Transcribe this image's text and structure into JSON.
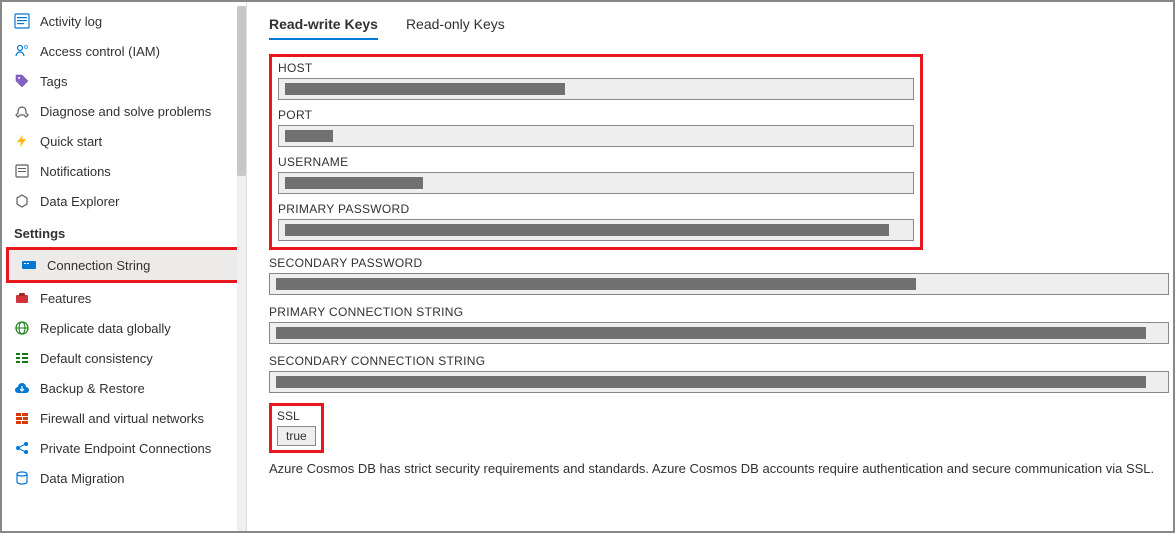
{
  "sidebar": {
    "top_items": [
      {
        "label": "Activity log",
        "icon": "activity"
      },
      {
        "label": "Access control (IAM)",
        "icon": "access"
      },
      {
        "label": "Tags",
        "icon": "tag"
      },
      {
        "label": "Diagnose and solve problems",
        "icon": "diagnose"
      },
      {
        "label": "Quick start",
        "icon": "quickstart"
      },
      {
        "label": "Notifications",
        "icon": "notifications"
      },
      {
        "label": "Data Explorer",
        "icon": "dataexplorer"
      }
    ],
    "settings_header": "Settings",
    "settings_items": [
      {
        "label": "Connection String",
        "icon": "connection",
        "active": true
      },
      {
        "label": "Features",
        "icon": "features"
      },
      {
        "label": "Replicate data globally",
        "icon": "replicate"
      },
      {
        "label": "Default consistency",
        "icon": "consistency"
      },
      {
        "label": "Backup & Restore",
        "icon": "backup"
      },
      {
        "label": "Firewall and virtual networks",
        "icon": "firewall"
      },
      {
        "label": "Private Endpoint Connections",
        "icon": "endpoint"
      },
      {
        "label": "Data Migration",
        "icon": "migration"
      }
    ]
  },
  "tabs": {
    "readwrite": "Read-write Keys",
    "readonly": "Read-only Keys"
  },
  "fields": {
    "host": {
      "label": "HOST",
      "redact_width": 280
    },
    "port": {
      "label": "PORT",
      "redact_width": 48
    },
    "username": {
      "label": "USERNAME",
      "redact_width": 138
    },
    "primary_password": {
      "label": "PRIMARY PASSWORD",
      "redact_width": 604
    },
    "secondary_password": {
      "label": "SECONDARY PASSWORD",
      "redact_width": 640
    },
    "primary_conn": {
      "label": "PRIMARY CONNECTION STRING",
      "redact_width": 870
    },
    "secondary_conn": {
      "label": "SECONDARY CONNECTION STRING",
      "redact_width": 870
    },
    "ssl": {
      "label": "SSL",
      "value": "true"
    }
  },
  "footer": "Azure Cosmos DB has strict security requirements and standards. Azure Cosmos DB accounts require authentication and secure communication via SSL."
}
